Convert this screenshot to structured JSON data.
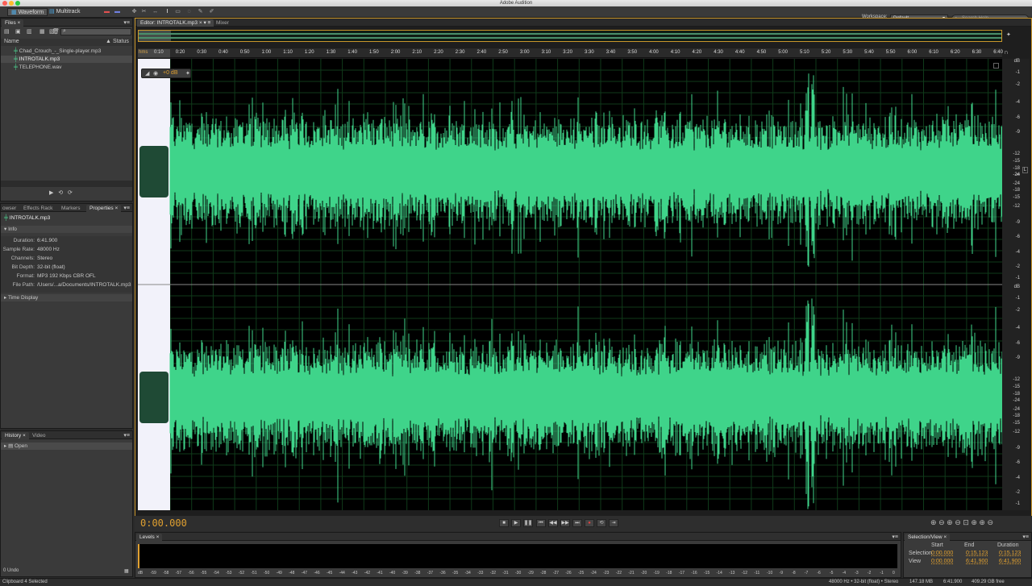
{
  "app": {
    "title": "Adobe Audition"
  },
  "toolbar": {
    "waveform_label": "Waveform",
    "multitrack_label": "Multitrack",
    "workspace_label": "Workspace:",
    "workspace_value": "Default",
    "search_placeholder": "Search Help"
  },
  "files_panel": {
    "tab": "Files",
    "col_name": "Name",
    "col_status": "Status",
    "files": [
      {
        "name": "Chad_Crouch_-_Single-player.mp3"
      },
      {
        "name": "INTROTALK.mp3"
      },
      {
        "name": "TELEPHONE.wav"
      }
    ]
  },
  "props_panel": {
    "tabs": [
      "owser",
      "Effects Rack",
      "Markers",
      "Properties"
    ],
    "file_name": "INTROTALK.mp3",
    "info_label": "Info",
    "info": [
      {
        "k": "Duration:",
        "v": "6:41.900"
      },
      {
        "k": "Sample Rate:",
        "v": "48000 Hz"
      },
      {
        "k": "Channels:",
        "v": "Stereo"
      },
      {
        "k": "Bit Depth:",
        "v": "32-bit (float)"
      },
      {
        "k": "Format:",
        "v": "MP3 192 Kbps CBR OFL"
      },
      {
        "k": "File Path:",
        "v": "/Users/...a/Documents/INTROTALK.mp3"
      }
    ],
    "time_display_label": "Time Display"
  },
  "history_panel": {
    "tabs": [
      "History",
      "Video"
    ],
    "items": [
      "Open"
    ],
    "undo": "0 Undo"
  },
  "editor": {
    "tab_editor": "Editor: INTROTALK.mp3",
    "tab_mixer": "Mixer",
    "hms_label": "hms",
    "ruler_ticks": [
      "0:10",
      "0:20",
      "0:30",
      "0:40",
      "0:50",
      "1:00",
      "1:10",
      "1:20",
      "1:30",
      "1:40",
      "1:50",
      "2:00",
      "2:10",
      "2:20",
      "2:30",
      "2:40",
      "2:50",
      "3:00",
      "3:10",
      "3:20",
      "3:30",
      "3:40",
      "3:50",
      "4:00",
      "4:10",
      "4:20",
      "4:30",
      "4:40",
      "4:50",
      "5:00",
      "5:10",
      "5:20",
      "5:30",
      "5:40",
      "5:50",
      "6:00",
      "6:10",
      "6:20",
      "6:30",
      "6:40"
    ],
    "db_labels": [
      "dB",
      "-1",
      "-2",
      "-4",
      "-6",
      "-9",
      "-12",
      "-15",
      "-18",
      "-24",
      "-∞",
      "-24",
      "-18",
      "-15",
      "-12",
      "-9",
      "-6",
      "-4",
      "-2",
      "-1"
    ],
    "channel_L": "L",
    "gain_value": "+0 dB",
    "current_time": "0:00.000",
    "wave_color": "#3fd48a",
    "grid_color": "#0f3a1a"
  },
  "levels_panel": {
    "tab": "Levels",
    "ticks": [
      "dB",
      "-59",
      "-58",
      "-57",
      "-56",
      "-55",
      "-54",
      "-53",
      "-52",
      "-51",
      "-50",
      "-49",
      "-48",
      "-47",
      "-46",
      "-45",
      "-44",
      "-43",
      "-42",
      "-41",
      "-40",
      "-39",
      "-38",
      "-37",
      "-36",
      "-35",
      "-34",
      "-33",
      "-32",
      "-31",
      "-30",
      "-29",
      "-28",
      "-27",
      "-26",
      "-25",
      "-24",
      "-23",
      "-22",
      "-21",
      "-20",
      "-19",
      "-18",
      "-17",
      "-16",
      "-15",
      "-14",
      "-13",
      "-12",
      "-11",
      "-10",
      "-9",
      "-8",
      "-7",
      "-6",
      "-5",
      "-4",
      "-3",
      "-2",
      "-1",
      "0"
    ]
  },
  "selview_panel": {
    "tab": "Selection/View",
    "headers": [
      "Start",
      "End",
      "Duration"
    ],
    "rows": [
      {
        "label": "Selection",
        "start": "0:00.000",
        "end": "0:15.123",
        "duration": "0:15.123"
      },
      {
        "label": "View",
        "start": "0:00.000",
        "end": "6:41.900",
        "duration": "6:41.900"
      }
    ]
  },
  "status": {
    "left": "Clipboard 4 Selected",
    "format": "48000 Hz • 32-bit (float) • Stereo",
    "size": "147.18 MB",
    "duration": "6:41.900",
    "free": "409.29 GB free"
  }
}
